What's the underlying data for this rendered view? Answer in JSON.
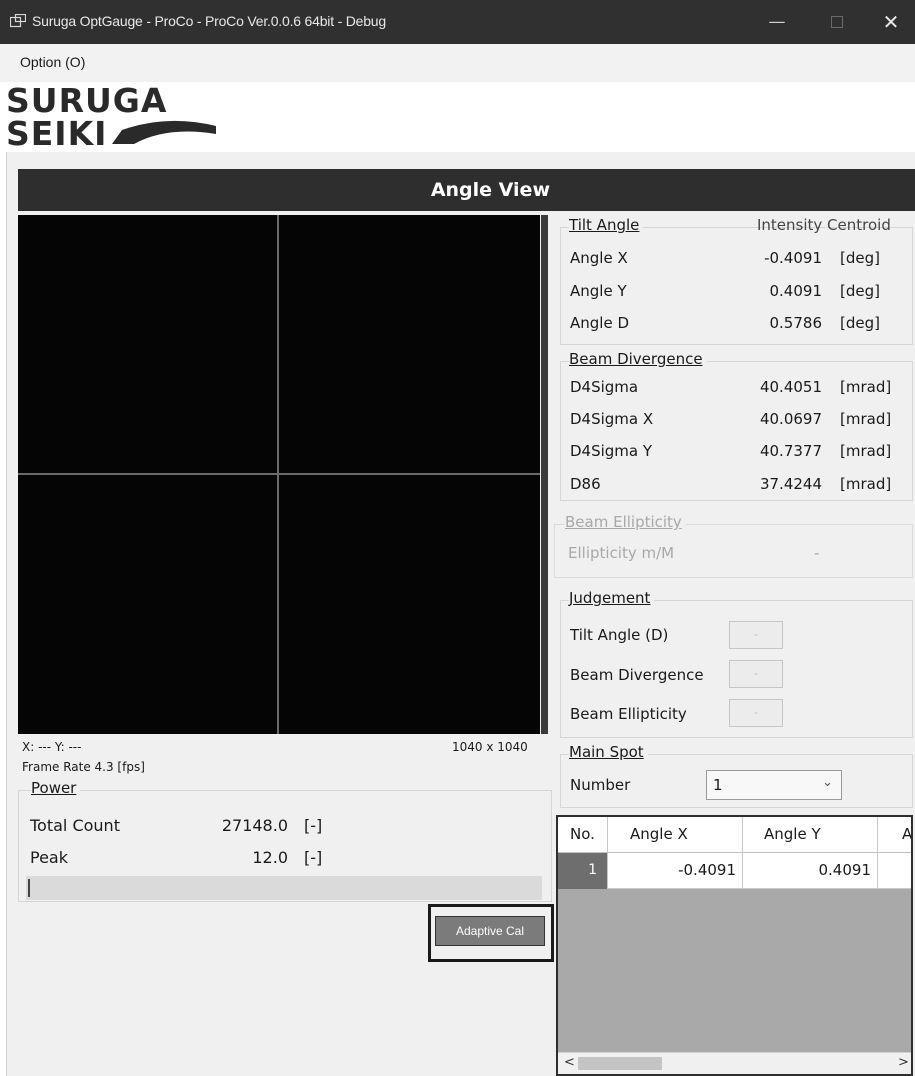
{
  "window": {
    "title": "Suruga OptGauge - ProCo - ProCo Ver.0.0.6 64bit - Debug",
    "minimize_glyph": "—",
    "close_glyph": "✕"
  },
  "menu": {
    "items": [
      "Option (O)"
    ]
  },
  "logo": {
    "line1": "SURUGA",
    "line2": "SEIKI"
  },
  "header": {
    "title": "Angle View"
  },
  "viewer": {
    "coords": "X: --- Y: ---",
    "resolution": "1040 x 1040",
    "frame_rate": "Frame Rate  4.3  [fps]"
  },
  "power": {
    "title": "Power",
    "rows": [
      {
        "label": "Total Count",
        "value": "27148.0",
        "unit": "[-]"
      },
      {
        "label": "Peak",
        "value": "12.0",
        "unit": "[-]"
      }
    ],
    "bar_fraction": 0.0
  },
  "adaptive_cal": {
    "label": "Adaptive Cal"
  },
  "tilt": {
    "title": "Tilt Angle",
    "mode": "Intensity Centroid",
    "rows": [
      {
        "label": "Angle X",
        "value": "-0.4091",
        "unit": "[deg]"
      },
      {
        "label": "Angle Y",
        "value": "0.4091",
        "unit": "[deg]"
      },
      {
        "label": "Angle D",
        "value": "0.5786",
        "unit": "[deg]"
      }
    ]
  },
  "divergence": {
    "title": "Beam Divergence",
    "rows": [
      {
        "label": "D4Sigma",
        "value": "40.4051",
        "unit": "[mrad]"
      },
      {
        "label": "D4Sigma X",
        "value": "40.0697",
        "unit": "[mrad]"
      },
      {
        "label": "D4Sigma Y",
        "value": "40.7377",
        "unit": "[mrad]"
      },
      {
        "label": "D86",
        "value": "37.4244",
        "unit": "[mrad]"
      }
    ]
  },
  "ellipticity": {
    "title": "Beam Ellipticity",
    "label": "Ellipticity m/M",
    "value": "-"
  },
  "judgement": {
    "title": "Judgement",
    "rows": [
      {
        "label": "Tilt Angle (D)",
        "value": "-"
      },
      {
        "label": "Beam Divergence",
        "value": "-"
      },
      {
        "label": "Beam Ellipticity",
        "value": "-"
      }
    ]
  },
  "main_spot": {
    "title": "Main Spot",
    "label": "Number",
    "selected": "1"
  },
  "table": {
    "columns": [
      "No.",
      "Angle X",
      "Angle Y",
      "A"
    ],
    "rows": [
      {
        "no": "1",
        "angle_x": "-0.4091",
        "angle_y": "0.4091",
        "extra": ""
      }
    ],
    "scroll_left": "<",
    "scroll_right": ">"
  }
}
